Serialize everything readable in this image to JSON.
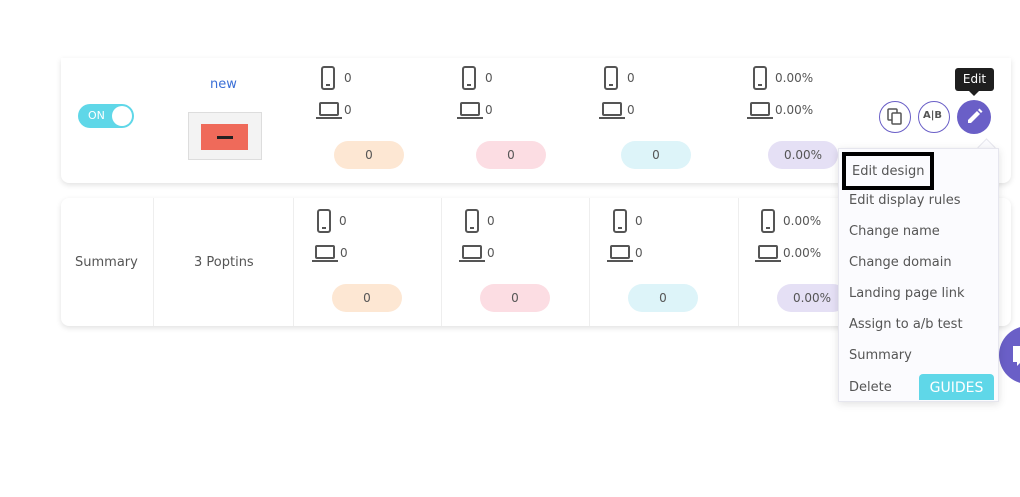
{
  "poptin_row": {
    "toggle_label": "ON",
    "name_link": "new",
    "columns": [
      {
        "mobile": "0",
        "desktop": "0",
        "total": "0",
        "color": "#fde7d3"
      },
      {
        "mobile": "0",
        "desktop": "0",
        "total": "0",
        "color": "#fcdde3"
      },
      {
        "mobile": "0",
        "desktop": "0",
        "total": "0",
        "color": "#ddf4f9"
      },
      {
        "mobile": "0.00%",
        "desktop": "0.00%",
        "total": "0.00%",
        "color": "#e5e0f5"
      }
    ]
  },
  "summary_row": {
    "label": "Summary",
    "count": "3 Poptins",
    "columns": [
      {
        "mobile": "0",
        "desktop": "0",
        "total": "0"
      },
      {
        "mobile": "0",
        "desktop": "0",
        "total": "0"
      },
      {
        "mobile": "0",
        "desktop": "0",
        "total": "0"
      },
      {
        "mobile": "0.00%",
        "desktop": "0.00%",
        "total": "0.00%"
      }
    ]
  },
  "actions": {
    "ab_label": "A|B",
    "tooltip": "Edit"
  },
  "menu": {
    "items": [
      "Edit design",
      "Edit display rules",
      "Change name",
      "Change domain",
      "Landing page link",
      "Assign to a/b test",
      "Summary",
      "Delete"
    ]
  },
  "guides_label": "GUIDES",
  "colors": {
    "accent": "#6a5fc7",
    "toggle": "#5fd7e8"
  }
}
